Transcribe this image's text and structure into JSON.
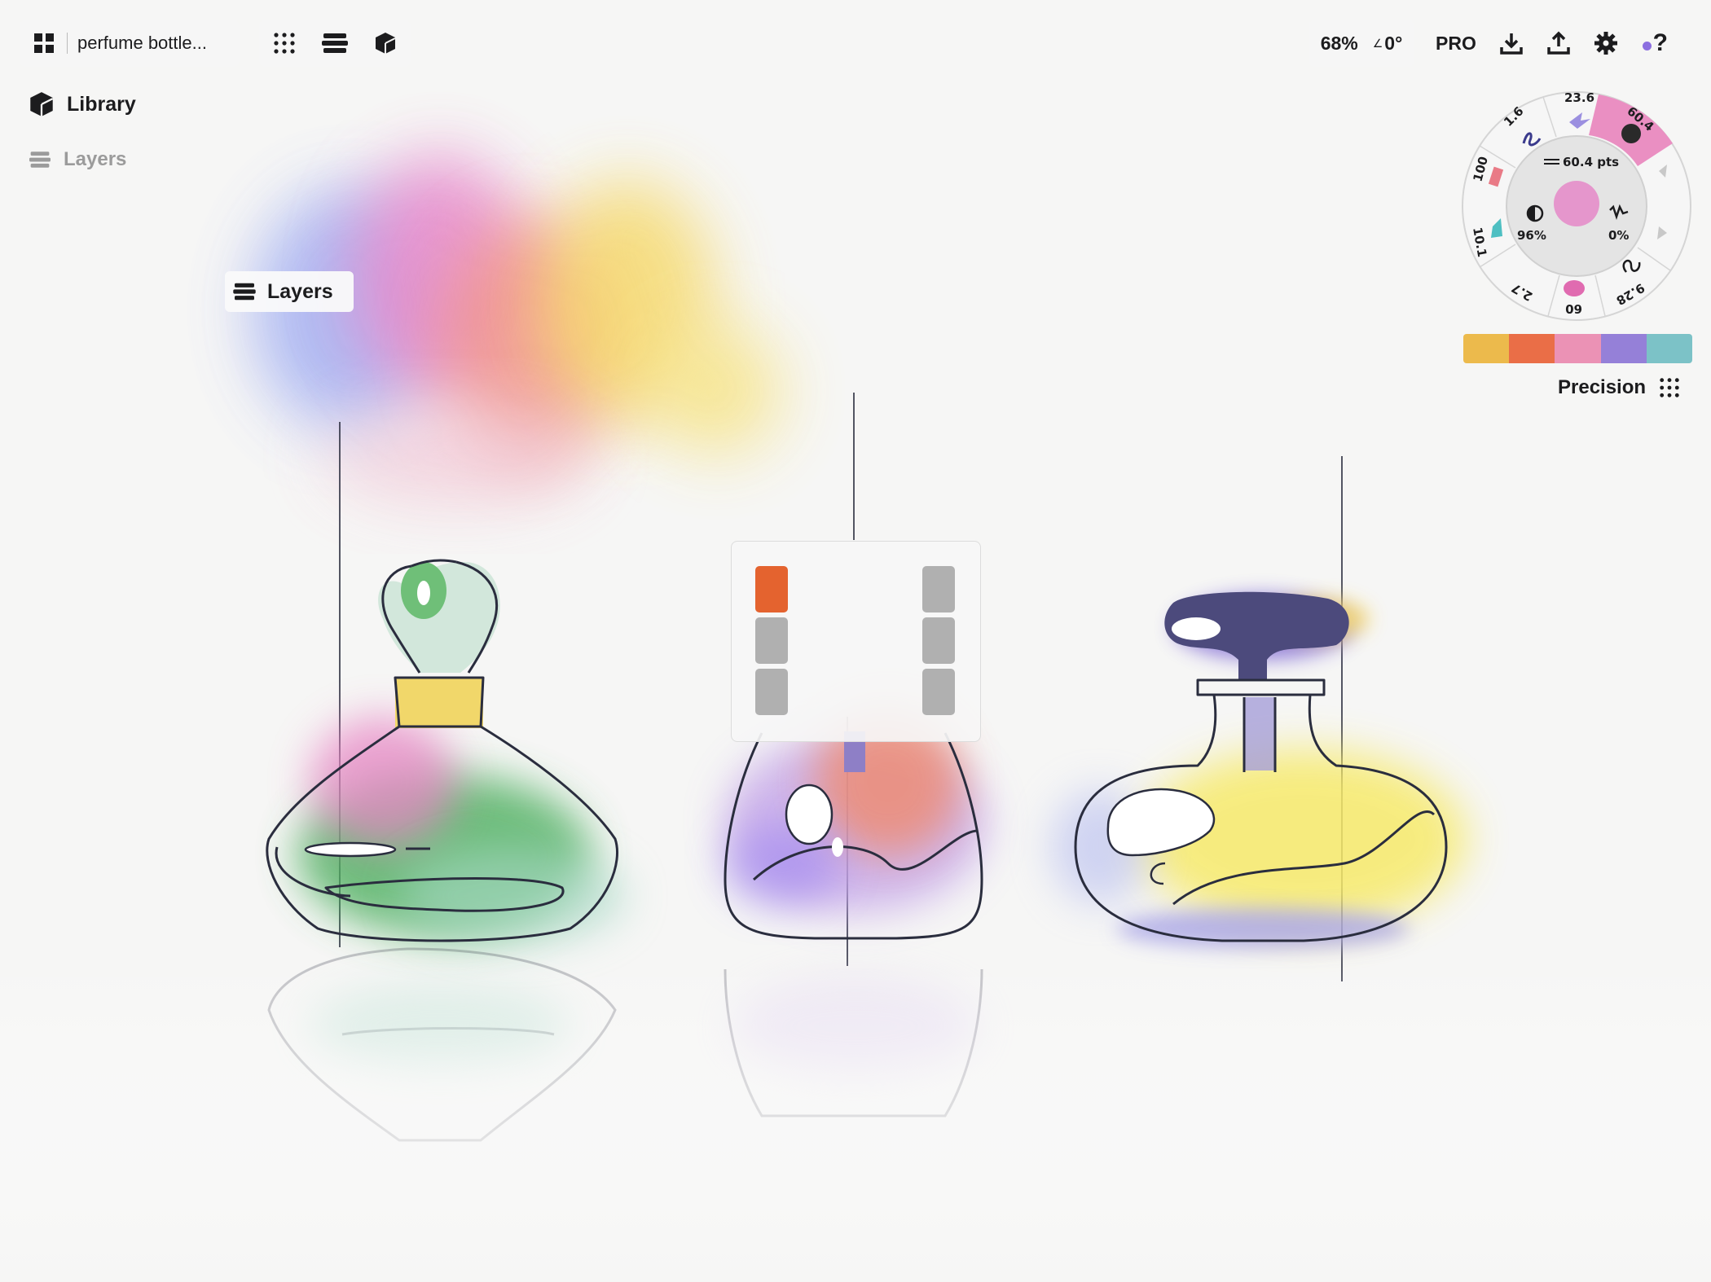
{
  "toolbar": {
    "document_title": "perfume bottle...",
    "zoom": "68%",
    "rotation": "0°",
    "pro_label": "PRO"
  },
  "side_menu": {
    "library_label": "Library",
    "layers_label": "Layers"
  },
  "layers_tooltip": {
    "label": "Layers"
  },
  "brush_wheel": {
    "size_label": "60.4 pts",
    "opacity": "96%",
    "smoothing": "0%",
    "presets": [
      "23.6",
      "60.4",
      "1.6",
      "100",
      "10.1",
      "2.7",
      "60",
      "9.28"
    ],
    "current_color": "#e596cc"
  },
  "palette": {
    "colors": [
      "#ecba4c",
      "#ea6e47",
      "#eb92b5",
      "#9580d8",
      "#7cc2c7"
    ]
  },
  "precision": {
    "label": "Precision"
  },
  "layers_panel": {
    "left_chip_colors": [
      "#e4632f",
      "#b0b0b0",
      "#b0b0b0"
    ],
    "right_chip_colors": [
      "#b0b0b0",
      "#b0b0b0",
      "#b0b0b0"
    ]
  },
  "colors": {
    "accent_purple": "#8c6fe0",
    "wheel_highlight": "#ea8fc2"
  }
}
